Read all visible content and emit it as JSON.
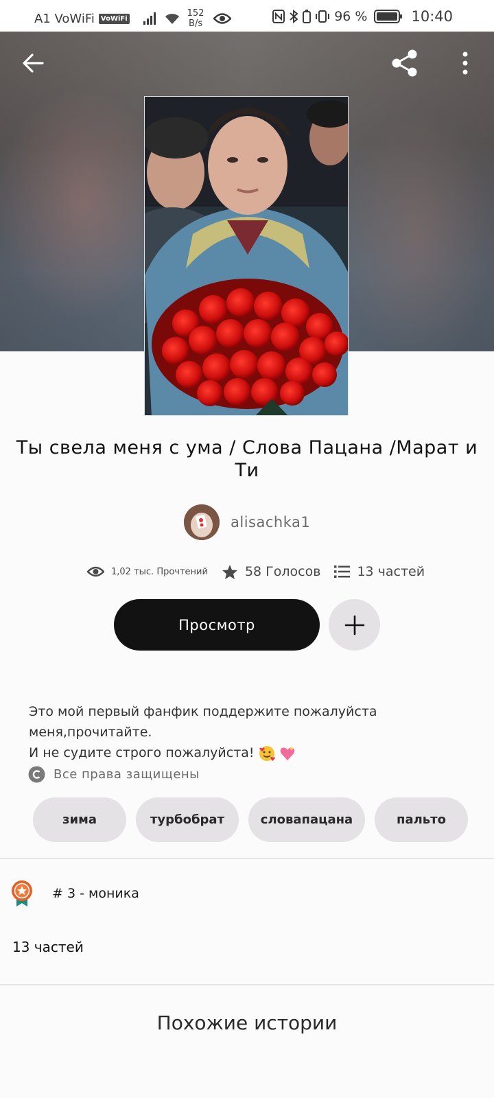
{
  "status_bar": {
    "carrier": "A1 VoWiFi",
    "vowifi_badge": "VoWiFi",
    "speed_value": "152",
    "speed_unit": "B/s",
    "battery_percent": "96 %",
    "time": "10:40",
    "icons": [
      "signal-icon",
      "wifi-icon",
      "eye-icon",
      "nfc-icon",
      "bluetooth-icon",
      "vibrate-icon",
      "battery-icon"
    ]
  },
  "toolbar": {
    "back_icon": "arrow-left-icon",
    "share_icon": "share-icon",
    "more_icon": "more-vertical-icon"
  },
  "story": {
    "title": "Ты свела меня с ума / Слова Пацана /Марат и Ти",
    "author": "alisachka1",
    "stats": {
      "reads": "1,02 тыс. Прочтений",
      "votes": "58 Голосов",
      "parts": "13 частей"
    },
    "read_button": "Просмотр",
    "description_line1": "Это мой первый фанфик поддержите пожалуйста меня,прочитайте.",
    "description_line2": "И не судите строго пожалуйста!",
    "copyright": "Все права защищены",
    "tags": [
      "зима",
      "турбобрат",
      "словапацана",
      "пальто"
    ],
    "rank": "# 3 - моника",
    "parts_heading": "13 частей"
  },
  "similar": {
    "title": "Похожие истории"
  },
  "colors": {
    "primary_button": "#121212",
    "chip_bg": "#e4e2e4",
    "rank_badge": "#e0642a",
    "rank_ribbon": "#1f8a7a"
  }
}
